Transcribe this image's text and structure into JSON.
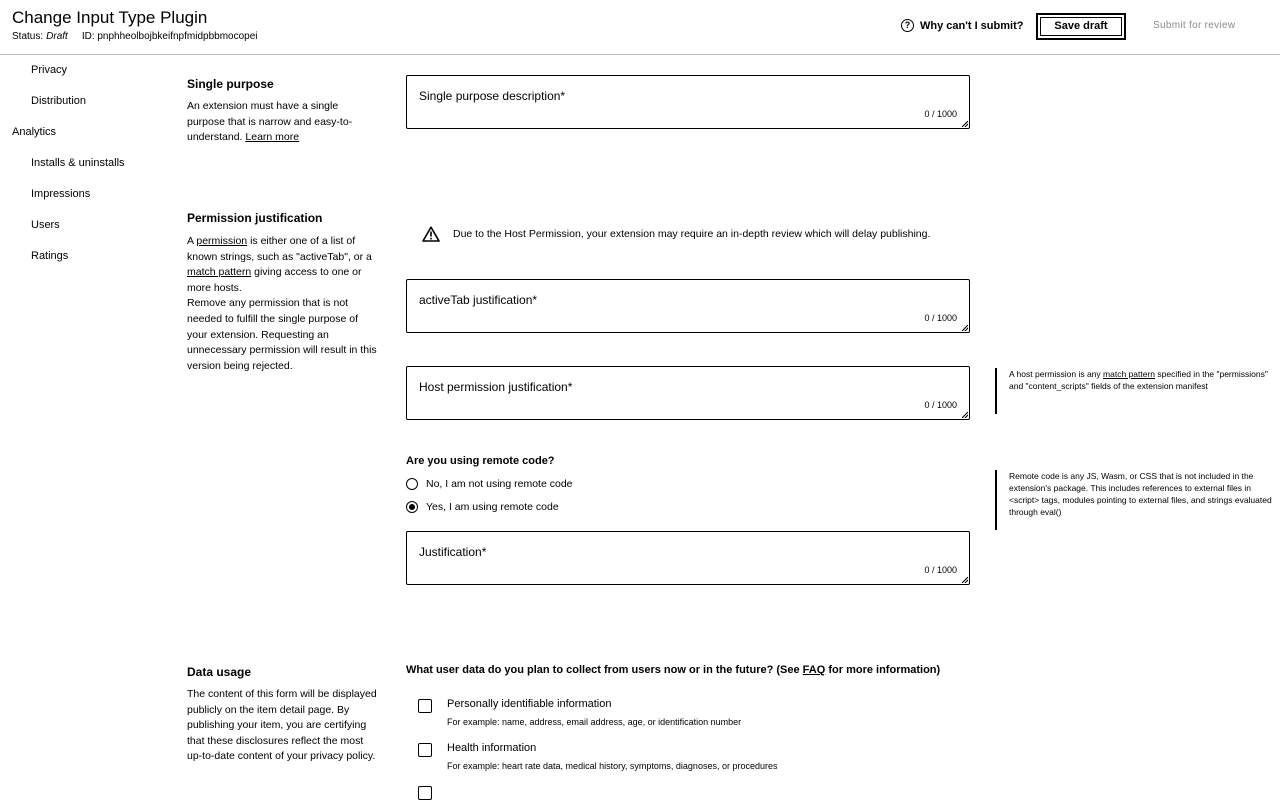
{
  "header": {
    "title": "Change Input Type Plugin",
    "status_label": "Status:",
    "status_value": "Draft",
    "id_text": "ID: pnphheolbojbkeifnpfmidpbbmocopei",
    "why_label": "Why can't I submit?",
    "save_label": "Save draft",
    "submit_label": "Submit for review"
  },
  "sidebar": {
    "items": [
      {
        "label": "Privacy"
      },
      {
        "label": "Distribution"
      },
      {
        "label": "Analytics"
      },
      {
        "label": "Installs & uninstalls"
      },
      {
        "label": "Impressions"
      },
      {
        "label": "Users"
      },
      {
        "label": "Ratings"
      }
    ]
  },
  "single_purpose": {
    "title": "Single purpose",
    "desc": "An extension must have a single purpose that is narrow and easy-to-understand.",
    "learn_more": "Learn more",
    "field_label": "Single purpose description*",
    "counter": "0 / 1000"
  },
  "permission": {
    "title": "Permission justification",
    "desc_1": "A",
    "link_permission": "permission",
    "desc_2": "is either one of a list of known strings, such as \"activeTab\", or a",
    "link_match": "match pattern",
    "desc_3": "giving access to one or more hosts.",
    "desc_4": "Remove any permission that is not needed to fulfill the single purpose of your extension. Requesting an unnecessary permission will result in this version being rejected.",
    "warning": "Due to the Host Permission, your extension may require an in-depth review which will delay publishing.",
    "active_tab_label": "activeTab justification*",
    "active_tab_counter": "0 / 1000",
    "host_label": "Host permission justification*",
    "host_counter": "0 / 1000",
    "host_help_1": "A host permission is any",
    "host_help_link": "match pattern",
    "host_help_2": "specified in the \"permissions\" and \"content_scripts\" fields of the extension manifest"
  },
  "remote_code": {
    "question": "Are you using remote code?",
    "option_no": "No, I am not using remote code",
    "option_yes": "Yes, I am using remote code",
    "selected": "yes",
    "justification_label": "Justification*",
    "justification_counter": "0 / 1000",
    "help": "Remote code is any JS, Wasm, or CSS that is not included in the extension's package. This includes references to external files in <script> tags, modules pointing to external files, and strings evaluated through eval()"
  },
  "data_usage": {
    "title": "Data usage",
    "desc": "The content of this form will be displayed publicly on the item detail page. By publishing your item, you are certifying that these disclosures reflect the most up-to-date content of your privacy policy.",
    "question_1": "What user data do you plan to collect from users now or in the future? (See",
    "faq_link": "FAQ",
    "question_2": "for more information)",
    "items": [
      {
        "label": "Personally identifiable information",
        "sub": "For example: name, address, email address, age, or identification number"
      },
      {
        "label": "Health information",
        "sub": "For example: heart rate data, medical history, symptoms, diagnoses, or procedures"
      }
    ]
  }
}
